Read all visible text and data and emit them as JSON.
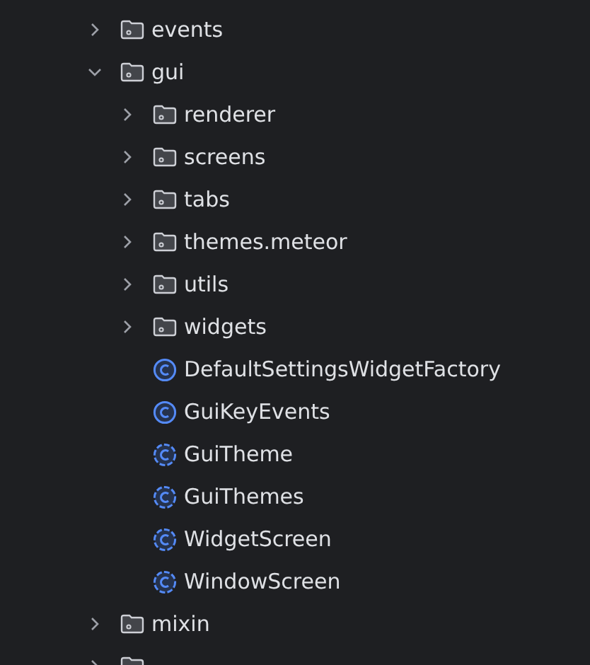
{
  "tree": [
    {
      "name": "events",
      "kind": "folder",
      "expanded": false
    },
    {
      "name": "gui",
      "kind": "folder",
      "expanded": true,
      "children": [
        {
          "name": "renderer",
          "kind": "folder",
          "expanded": false
        },
        {
          "name": "screens",
          "kind": "folder",
          "expanded": false
        },
        {
          "name": "tabs",
          "kind": "folder",
          "expanded": false
        },
        {
          "name": "themes.meteor",
          "kind": "folder",
          "expanded": false
        },
        {
          "name": "utils",
          "kind": "folder",
          "expanded": false
        },
        {
          "name": "widgets",
          "kind": "folder",
          "expanded": false
        },
        {
          "name": "DefaultSettingsWidgetFactory",
          "kind": "class"
        },
        {
          "name": "GuiKeyEvents",
          "kind": "class"
        },
        {
          "name": "GuiTheme",
          "kind": "abstract_class"
        },
        {
          "name": "GuiThemes",
          "kind": "abstract_class"
        },
        {
          "name": "WidgetScreen",
          "kind": "abstract_class"
        },
        {
          "name": "WindowScreen",
          "kind": "abstract_class"
        }
      ]
    },
    {
      "name": "mixin",
      "kind": "folder",
      "expanded": false
    },
    {
      "kind": "folder",
      "expanded": false
    }
  ]
}
